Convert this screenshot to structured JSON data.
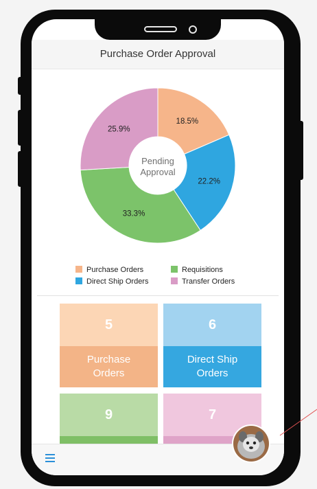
{
  "header": {
    "title": "Purchase Order Approval"
  },
  "chart_data": {
    "type": "pie",
    "center_label_line1": "Pending",
    "center_label_line2": "Approval",
    "slices": [
      {
        "name": "Purchase Orders",
        "value": 18.5,
        "label": "18.5%",
        "color": "#f6b58a"
      },
      {
        "name": "Direct Ship Orders",
        "value": 22.2,
        "label": "22.2%",
        "color": "#2fa6e0"
      },
      {
        "name": "Requisitions",
        "value": 33.3,
        "label": "33.3%",
        "color": "#7cc36a"
      },
      {
        "name": "Transfer Orders",
        "value": 25.9,
        "label": "25.9%",
        "color": "#d99cc6"
      }
    ],
    "legend": [
      "Purchase Orders",
      "Requisitions",
      "Direct Ship Orders",
      "Transfer Orders"
    ]
  },
  "tiles": [
    {
      "count": "5",
      "label_line1": "Purchase",
      "label_line2": "Orders",
      "top_color": "#fcd6b5",
      "bottom_color": "#f3b487"
    },
    {
      "count": "6",
      "label_line1": "Direct Ship",
      "label_line2": "Orders",
      "top_color": "#a2d3f0",
      "bottom_color": "#35a7e0"
    },
    {
      "count": "9",
      "label_line1": "",
      "label_line2": "",
      "top_color": "#b9dba6",
      "bottom_color": "#7fbf66"
    },
    {
      "count": "7",
      "label_line1": "",
      "label_line2": "",
      "top_color": "#f0c7de",
      "bottom_color": "#dfa4c8"
    }
  ],
  "bottombar": {
    "menu_icon": "hamburger-menu-icon",
    "avatar_icon": "dog-avatar-icon"
  },
  "colors": {
    "accent": "#2a8fd9",
    "annotation": "#e05252"
  }
}
